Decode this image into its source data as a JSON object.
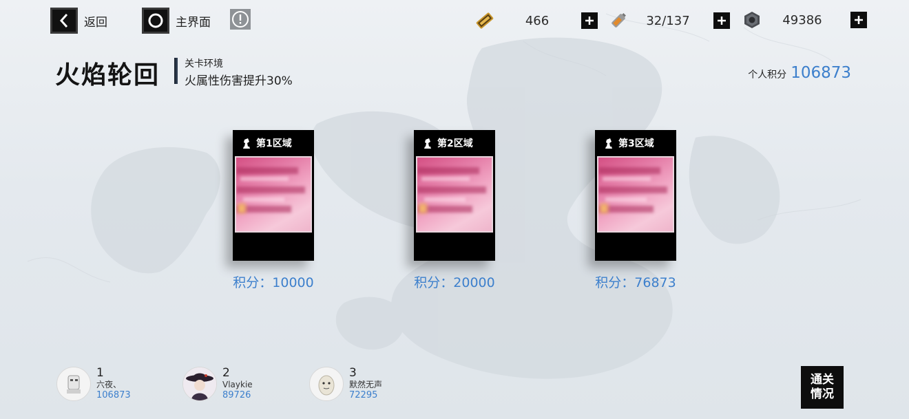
{
  "nav": {
    "back_label": "返回",
    "home_label": "主界面",
    "info_glyph": "!"
  },
  "resources": [
    {
      "icon": "ticket-icon",
      "value": "466"
    },
    {
      "icon": "battery-icon",
      "value": "32/137"
    },
    {
      "icon": "hex-nut-icon",
      "value": "49386"
    }
  ],
  "stage": {
    "title": "火焰轮回",
    "environment_label": "关卡环境",
    "environment_desc": "火属性伤害提升30%"
  },
  "personal": {
    "label": "个人积分",
    "value": "106873"
  },
  "zones": [
    {
      "title": "第1区域",
      "score": "积分：10000"
    },
    {
      "title": "第2区域",
      "score": "积分：20000"
    },
    {
      "title": "第3区域",
      "score": "积分：76873"
    }
  ],
  "leaderboard": [
    {
      "rank": "1",
      "name": "六夜、",
      "score": "106873"
    },
    {
      "rank": "2",
      "name": "Vlaykie",
      "score": "89726"
    },
    {
      "rank": "3",
      "name": "默然无声",
      "score": "72295"
    }
  ],
  "clear_button": {
    "line1": "通关",
    "line2": "情况"
  },
  "colors": {
    "accent_blue": "#3c7fcc",
    "card_black": "#000000",
    "card_image_pink": "#e47ba6"
  }
}
